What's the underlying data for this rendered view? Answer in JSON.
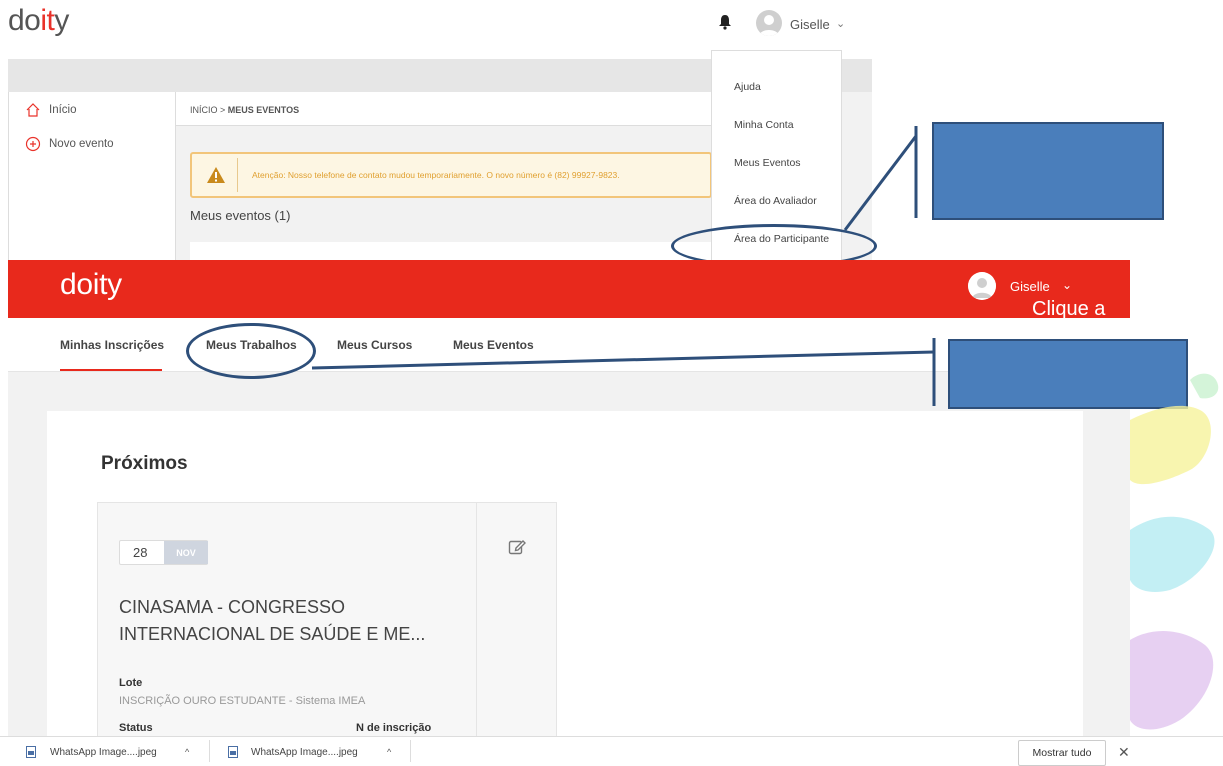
{
  "top_screen": {
    "logo_prefix": "do",
    "logo_mid": "it",
    "logo_suffix": "y",
    "user_name": "Giselle",
    "chevron": "⌄",
    "sidebar": [
      {
        "label": "Início",
        "icon": "home-icon"
      },
      {
        "label": "Novo evento",
        "icon": "plus-circle-icon"
      }
    ],
    "breadcrumb_prefix": "INÍCIO > ",
    "breadcrumb_current": "MEUS EVENTOS",
    "alert_text": "Atenção: Nosso telefone de contato mudou temporariamente. O novo número é (82) 99927-9823.",
    "my_events_heading": "Meus eventos (1)",
    "dropdown_items": [
      "Ajuda",
      "Minha Conta",
      "Meus Eventos",
      "Área do Avaliador",
      "Área do Participante"
    ]
  },
  "bottom_screen": {
    "logo": "doity",
    "user_name": "Giselle",
    "chevron": "⌄",
    "overlay_text": "Clique a",
    "tabs": [
      "Minhas Inscrições",
      "Meus Trabalhos",
      "Meus Cursos",
      "Meus Eventos"
    ],
    "section_title": "Próximos",
    "event": {
      "day": "28",
      "month": "NOV",
      "title": "CINASAMA - CONGRESSO INTERNACIONAL DE SAÚDE E ME...",
      "lote_label": "Lote",
      "lote_value": "INSCRIÇÃO OURO ESTUDANTE - Sistema IMEA",
      "status_label": "Status",
      "inscricao_label": "N de inscrição"
    }
  },
  "download_bar": {
    "files": [
      "WhatsApp Image....jpeg",
      "WhatsApp Image....jpeg"
    ],
    "chevron": "^",
    "show_all": "Mostrar tudo",
    "close": "✕"
  },
  "colors": {
    "brand_red": "#e8291c",
    "annotation_blue": "#4a7ebb",
    "annotation_outline": "#2e4f7a"
  }
}
